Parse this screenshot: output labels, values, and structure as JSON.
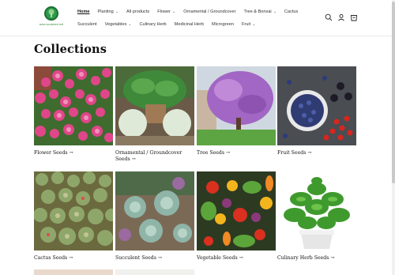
{
  "header": {
    "logo_url_text": "www.soulseed.net",
    "nav_row1": [
      {
        "label": "Home",
        "active": true,
        "dropdown": false
      },
      {
        "label": "Planting",
        "active": false,
        "dropdown": true
      },
      {
        "label": "All products",
        "active": false,
        "dropdown": false
      },
      {
        "label": "Flower",
        "active": false,
        "dropdown": true
      },
      {
        "label": "Ornamental / Groundcover",
        "active": false,
        "dropdown": false
      },
      {
        "label": "Tree & Bonsai",
        "active": false,
        "dropdown": true
      },
      {
        "label": "Cactus",
        "active": false,
        "dropdown": false
      }
    ],
    "nav_row2": [
      {
        "label": "Succulent",
        "active": false,
        "dropdown": false
      },
      {
        "label": "Vegetables",
        "active": false,
        "dropdown": true
      },
      {
        "label": "Culinary Herb",
        "active": false,
        "dropdown": false
      },
      {
        "label": "Medicinal Herb",
        "active": false,
        "dropdown": false
      },
      {
        "label": "Microgreen",
        "active": false,
        "dropdown": false
      },
      {
        "label": "Fruit",
        "active": false,
        "dropdown": true
      }
    ],
    "icons": [
      "search-icon",
      "account-icon",
      "cart-icon"
    ]
  },
  "page": {
    "title": "Collections"
  },
  "collections": [
    {
      "label": "Flower Seeds →",
      "image": "pink-roses"
    },
    {
      "label": "Ornamental / Groundcover Seeds →",
      "image": "hosta-planter"
    },
    {
      "label": "Tree Seeds →",
      "image": "purple-tree"
    },
    {
      "label": "Fruit Seeds →",
      "image": "berries-bowl"
    },
    {
      "label": "Cactus Seeds →",
      "image": "cactus-field"
    },
    {
      "label": "Succulent Seeds →",
      "image": "succulents"
    },
    {
      "label": "Vegetable Seeds →",
      "image": "vegetables"
    },
    {
      "label": "Culinary Herb Seeds →",
      "image": "basil-pot"
    }
  ],
  "colors": {
    "accent": "#121212",
    "logo_green": "#2e9a4a"
  }
}
